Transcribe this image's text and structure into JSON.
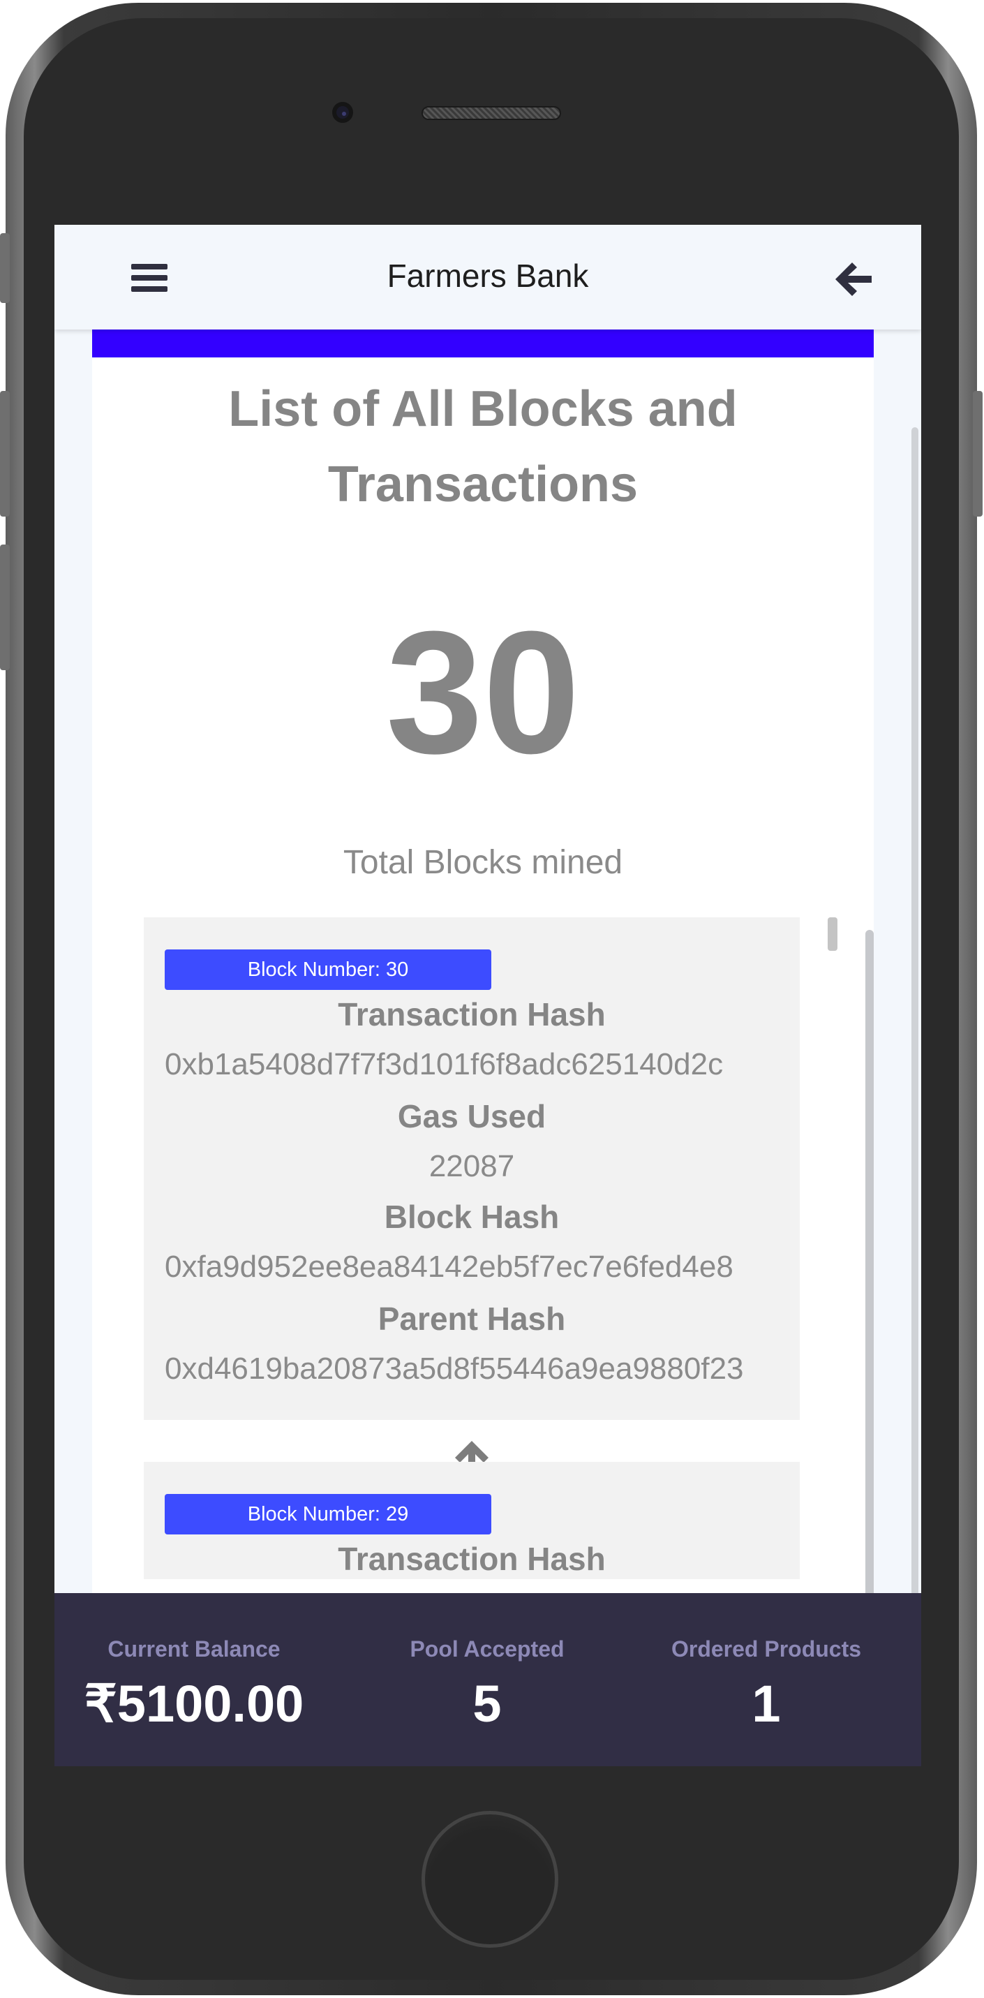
{
  "header": {
    "title": "Farmers Bank",
    "menu_icon": "hamburger-menu-icon",
    "back_icon": "arrow-left-icon"
  },
  "main": {
    "title": "List of All Blocks and Transactions",
    "block_count": "30",
    "block_count_caption": "Total Blocks mined",
    "accent_color": "#3300ff"
  },
  "blocks": [
    {
      "badge": "Block Number: 30",
      "tx_hash_label": "Transaction Hash",
      "tx_hash": "0xb1a5408d7f7f3d101f6f8adc625140d2c",
      "gas_label": "Gas Used",
      "gas_used": "22087",
      "block_hash_label": "Block Hash",
      "block_hash": "0xfa9d952ee8ea84142eb5f7ec7e6fed4e8",
      "parent_hash_label": "Parent Hash",
      "parent_hash": "0xd4619ba20873a5d8f55446a9ea9880f23"
    },
    {
      "badge": "Block Number: 29",
      "tx_hash_label": "Transaction Hash"
    }
  ],
  "footer": {
    "stats": [
      {
        "label": "Current Balance",
        "value": "₹5100.00"
      },
      {
        "label": "Pool Accepted",
        "value": "5"
      },
      {
        "label": "Ordered Products",
        "value": "1"
      }
    ]
  },
  "colors": {
    "badge": "#3d4cff",
    "footer_bg": "#312e45",
    "footer_label": "#8d89b6"
  }
}
